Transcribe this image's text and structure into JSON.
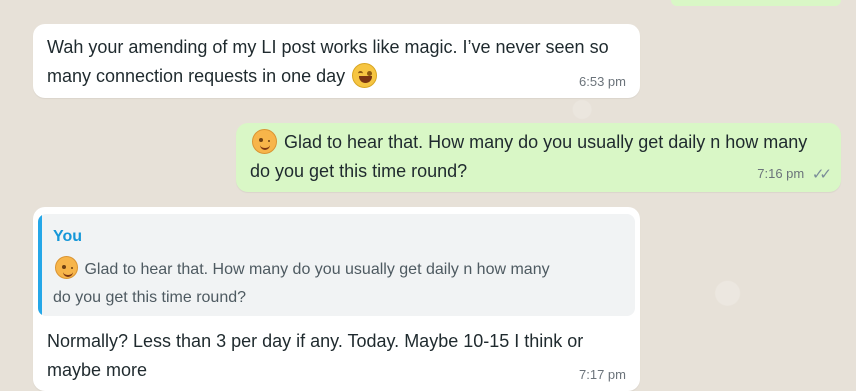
{
  "messages": [
    {
      "type": "incoming",
      "text_before_emoji": "Wah your amending of my LI post works like magic. I’ve never seen so many connection requests in one day",
      "emoji": "laughing-face-emoji",
      "time": "6:53 pm"
    },
    {
      "type": "outgoing",
      "emoji": "winking-face-emoji",
      "text_after_emoji": " Glad to hear that. How many do you usually get daily n how many do you get this time round?",
      "time": "7:16 pm",
      "status": "✓✓"
    },
    {
      "type": "incoming",
      "quote": {
        "author": "You",
        "emoji": "winking-face-emoji",
        "text_after_emoji": " Glad to hear that. How many do you usually get daily n how many do you get this time round?"
      },
      "text": "Normally? Less than 3 per day if any. Today. Maybe 10-15 I think or maybe more",
      "time": "7:17 pm"
    }
  ],
  "colors": {
    "chat_background": "#e7e1d8",
    "incoming_bubble": "#ffffff",
    "outgoing_bubble": "#d9f7c6",
    "quote_accent": "#25a7e8",
    "timestamp": "#6b737a"
  }
}
